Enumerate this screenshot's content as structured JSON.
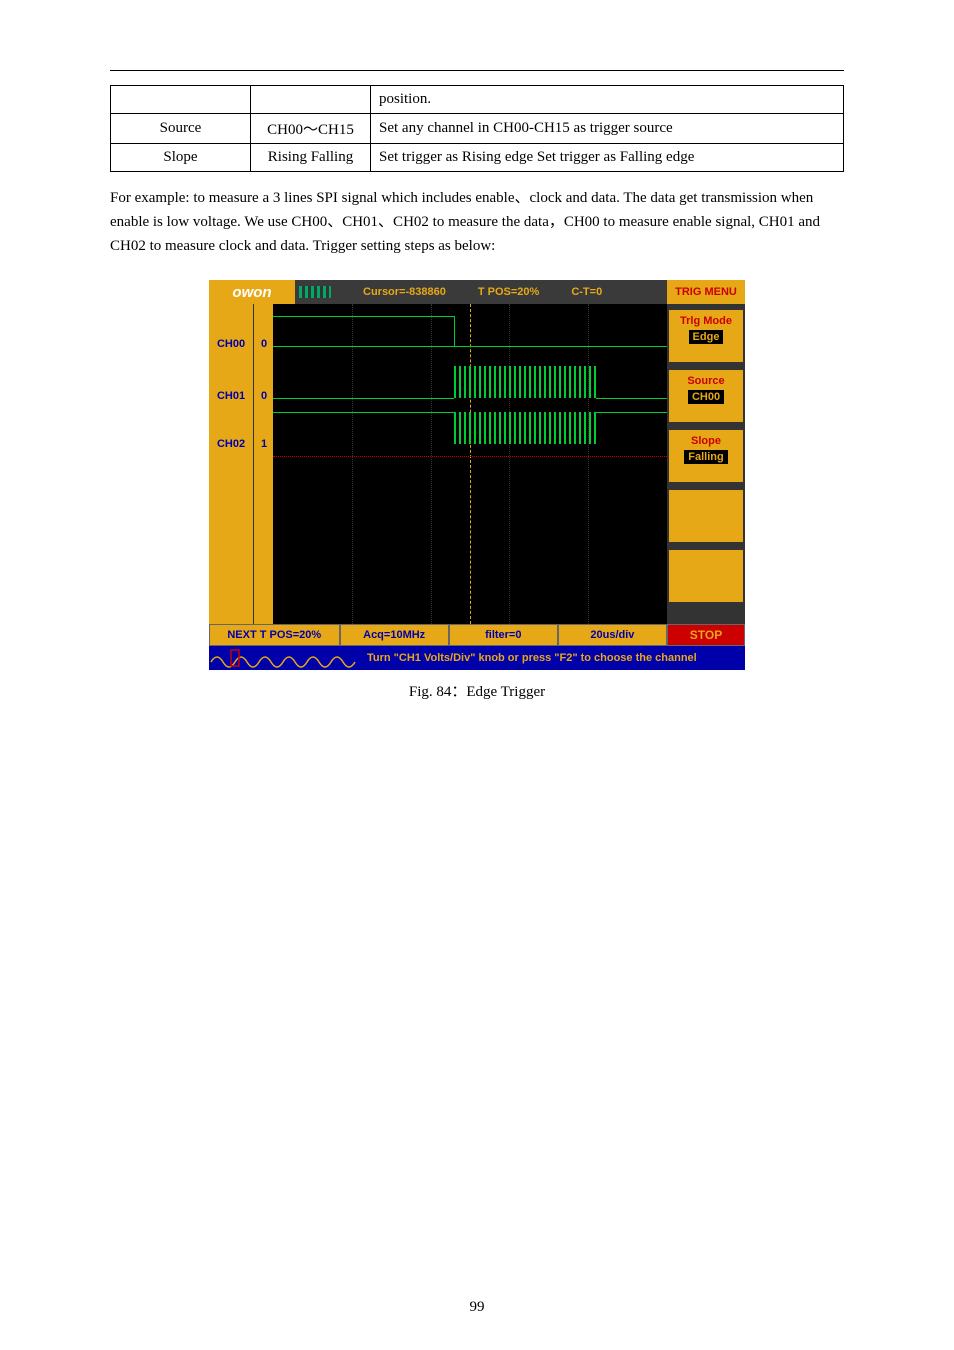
{
  "table": {
    "r1": {
      "c1": "",
      "c2": "",
      "c3": "position."
    },
    "r2": {
      "c1": "Source",
      "c2": "CH00～CH15",
      "c3": "Set any channel in CH00-CH15 as trigger source"
    },
    "r3": {
      "c1": "Slope",
      "c2": "Rising Falling",
      "c3": "Set trigger as Rising edge Set trigger as Falling edge"
    }
  },
  "para": "For example: to measure a 3 lines SPI signal which includes enable、clock and data. The data get transmission when enable is low voltage. We use CH00、CH01、CH02 to measure the data，CH00 to measure enable signal, CH01 and CH02 to measure clock and data. Trigger setting steps as below:",
  "scope": {
    "brand": "owon",
    "cursor": "Cursor=-838860",
    "tpos": "T POS=20%",
    "ct": "C-T=0",
    "trigMenuHead": "TRIG MENU",
    "ch": [
      {
        "label": "CH00",
        "num": "0"
      },
      {
        "label": "CH01",
        "num": "0"
      },
      {
        "label": "CH02",
        "num": "1"
      }
    ],
    "menu": [
      {
        "title": "Trlg Mode",
        "value": "Edge"
      },
      {
        "title": "Source",
        "value": "CH00"
      },
      {
        "title": "Slope",
        "value": "Falling"
      }
    ],
    "bottom1": {
      "a": "NEXT T POS=20%",
      "b": "Acq=10MHz",
      "c": "filter=0",
      "d": "20us/div"
    },
    "stop": "STOP",
    "hint": "Turn \"CH1 Volts/Div\" knob or press \"F2\" to choose the channel"
  },
  "figCaption": "Fig. 84：Edge Trigger",
  "pageNum": "99"
}
